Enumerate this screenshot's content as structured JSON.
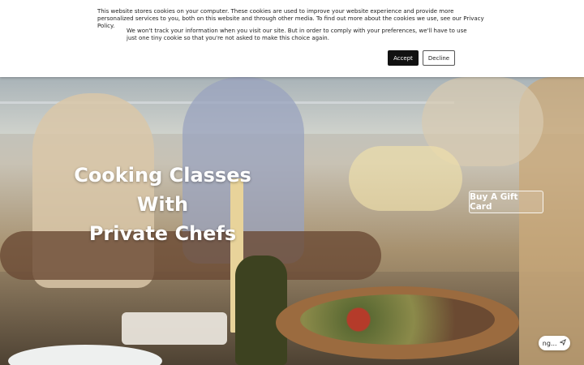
{
  "cookie_banner": {
    "text_primary": "This website stores cookies on your computer. These cookies are used to improve your website experience and provide more personalized services to you, both on this website and through other media. To find out more about the cookies we use, see our Privacy Policy.",
    "text_secondary": "We won't track your information when you visit our site. But in order to comply with your preferences, we'll have to use just one tiny cookie so that you're not asked to make this choice again.",
    "accept_label": "Accept",
    "decline_label": "Decline"
  },
  "hero": {
    "title_line1": "Cooking Classes With",
    "title_line2": "Private Chefs",
    "gift_card_label": "Buy A Gift Card"
  },
  "chat_widget": {
    "label": "ng...",
    "icon": "send-icon"
  },
  "colors": {
    "accept_bg": "#111111",
    "banner_bg": "#ffffff"
  }
}
